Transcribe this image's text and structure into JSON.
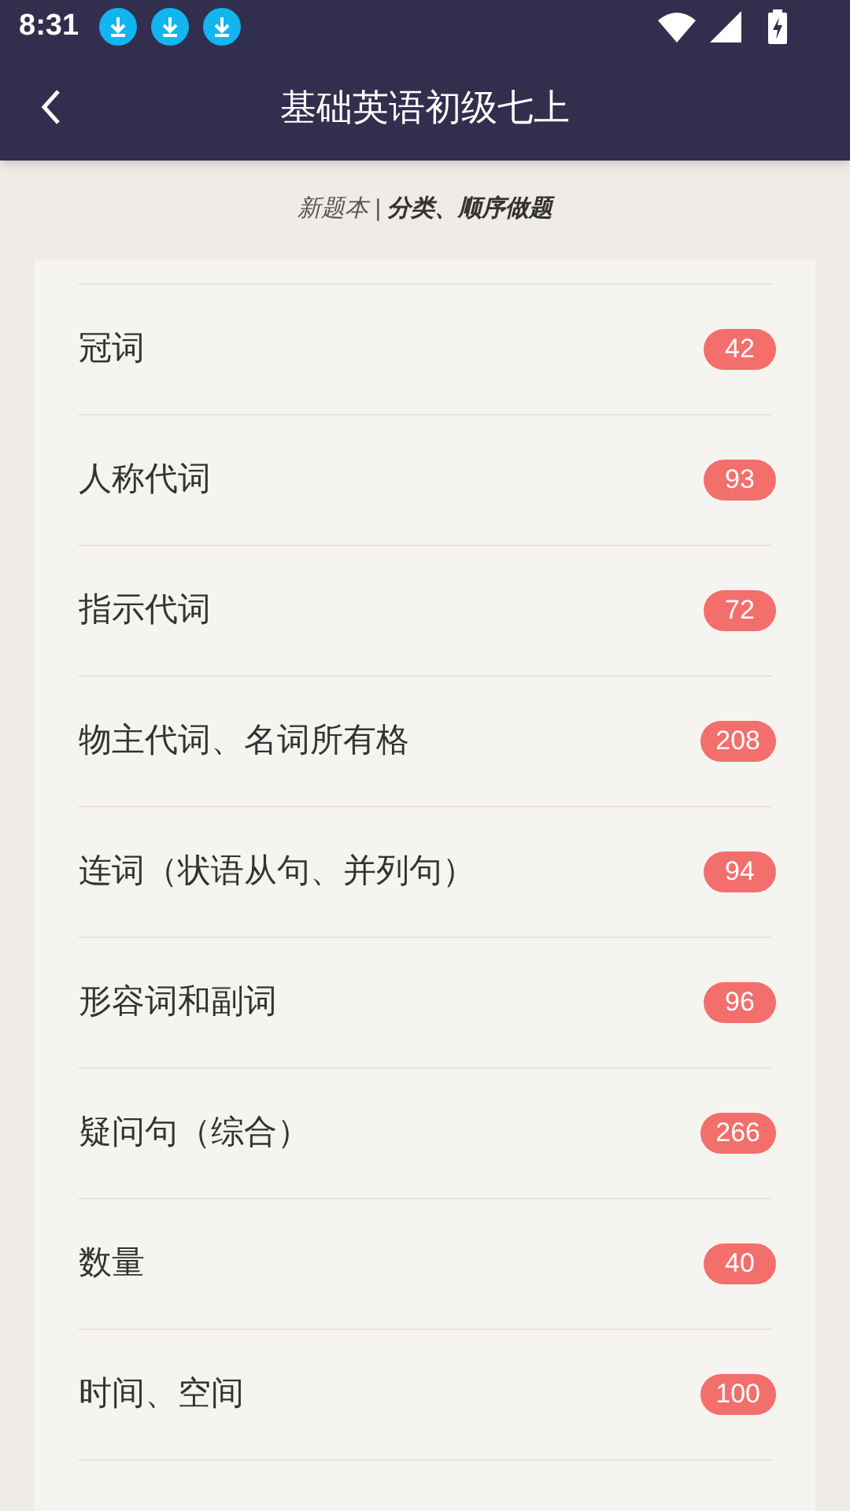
{
  "status_bar": {
    "time": "8:31"
  },
  "app_bar": {
    "title": "基础英语初级七上"
  },
  "subtitle": {
    "prefix": "新题本 | ",
    "emphasis": "分类、顺序做题"
  },
  "items": [
    {
      "label": "冠词",
      "count": "42"
    },
    {
      "label": "人称代词",
      "count": "93"
    },
    {
      "label": "指示代词",
      "count": "72"
    },
    {
      "label": "物主代词、名词所有格",
      "count": "208"
    },
    {
      "label": "连词（状语从句、并列句）",
      "count": "94"
    },
    {
      "label": "形容词和副词",
      "count": "96"
    },
    {
      "label": "疑问句（综合）",
      "count": "266"
    },
    {
      "label": "数量",
      "count": "40"
    },
    {
      "label": "时间、空间",
      "count": "100"
    }
  ]
}
